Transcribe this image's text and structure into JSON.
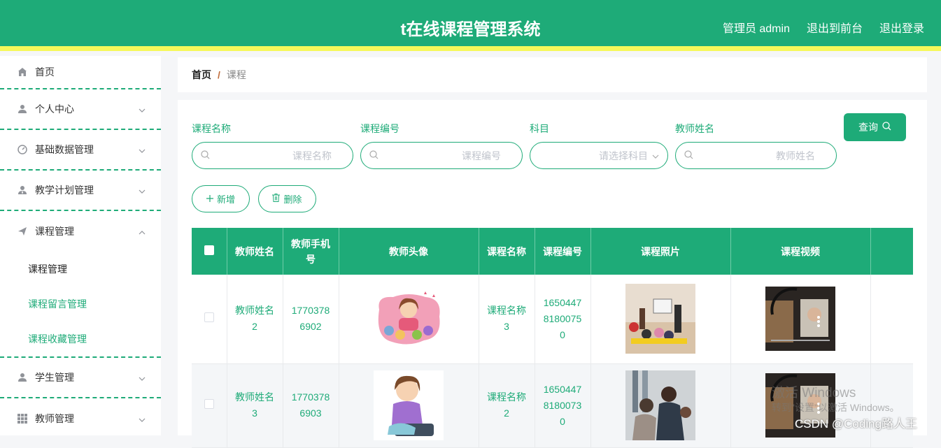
{
  "header": {
    "title": "t在线课程管理系统",
    "user": "管理员 admin",
    "back_to_front": "退出到前台",
    "logout": "退出登录"
  },
  "sidebar": {
    "items": [
      {
        "label": "首页",
        "icon": "home-icon"
      },
      {
        "label": "个人中心",
        "icon": "user-icon"
      },
      {
        "label": "基础数据管理",
        "icon": "gauge-icon"
      },
      {
        "label": "教学计划管理",
        "icon": "user-tie-icon"
      },
      {
        "label": "课程管理",
        "icon": "paper-plane-icon"
      },
      {
        "label": "学生管理",
        "icon": "user-icon"
      },
      {
        "label": "教师管理",
        "icon": "grid-icon"
      }
    ],
    "course_sub": [
      "课程管理",
      "课程留言管理",
      "课程收藏管理"
    ]
  },
  "breadcrumb": {
    "home": "首页",
    "sep": "/",
    "current": "课程"
  },
  "search": {
    "course_name_label": "课程名称",
    "course_name_placeholder": "课程名称",
    "course_no_label": "课程编号",
    "course_no_placeholder": "课程编号",
    "subject_label": "科目",
    "subject_placeholder": "请选择科目",
    "teacher_label": "教师姓名",
    "teacher_placeholder": "教师姓名",
    "query_button": "查询"
  },
  "actions": {
    "add": "新增",
    "delete": "删除"
  },
  "table": {
    "headers": [
      "教师姓名",
      "教师手机号",
      "教师头像",
      "课程名称",
      "课程编号",
      "课程照片",
      "课程视频"
    ],
    "rows": [
      {
        "teacher_name": "教师姓名2",
        "phone": "17703786902",
        "course_name": "课程名称3",
        "course_no": "16504478180075 0"
      },
      {
        "teacher_name": "教师姓名3",
        "phone": "17703786903",
        "course_name": "课程名称2",
        "course_no": "16504478180073 0"
      }
    ]
  },
  "overlay": {
    "activate_title": "激活 Windows",
    "activate_sub": "转到\"设置\"以激活 Windows。",
    "csdn": "CSDN @Coding路人王"
  }
}
